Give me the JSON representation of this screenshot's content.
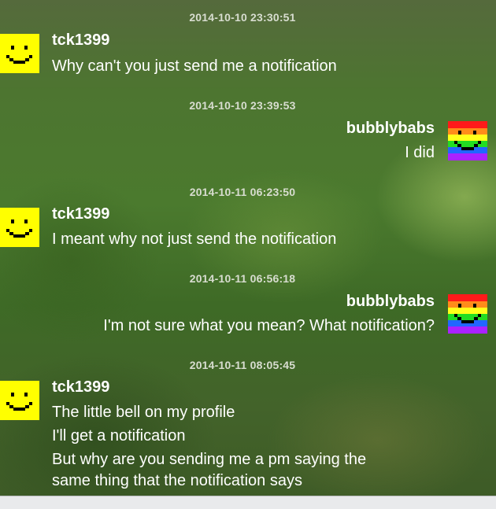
{
  "messages": [
    {
      "timestamp": "2014-10-10 23:30:51",
      "sender": "tck1399",
      "side": "left",
      "avatar": "smiley-face-icon",
      "lines": [
        "Why can't you just send me a notification"
      ]
    },
    {
      "timestamp": "2014-10-10 23:39:53",
      "sender": "bubblybabs",
      "side": "right",
      "avatar": "rainbow-face-icon",
      "lines": [
        "I did"
      ]
    },
    {
      "timestamp": "2014-10-11 06:23:50",
      "sender": "tck1399",
      "side": "left",
      "avatar": "smiley-face-icon",
      "lines": [
        "I meant why not just send the notification"
      ]
    },
    {
      "timestamp": "2014-10-11 06:56:18",
      "sender": "bubblybabs",
      "side": "right",
      "avatar": "rainbow-face-icon",
      "lines": [
        "I'm not sure what you mean?  What notification?"
      ]
    },
    {
      "timestamp": "2014-10-11 08:05:45",
      "sender": "tck1399",
      "side": "left",
      "avatar": "smiley-face-icon",
      "lines": [
        "The little bell on my profile",
        "I'll get a notification",
        "But why are you sending me a pm saying the",
        "same thing that the notification says"
      ]
    }
  ],
  "colors": {
    "smiley_yellow": "#ffff00",
    "smiley_black": "#000000",
    "rainbow": [
      "#ff1a1a",
      "#ff8c1a",
      "#ffff1a",
      "#22dd22",
      "#2266ff",
      "#aa22ff"
    ]
  }
}
